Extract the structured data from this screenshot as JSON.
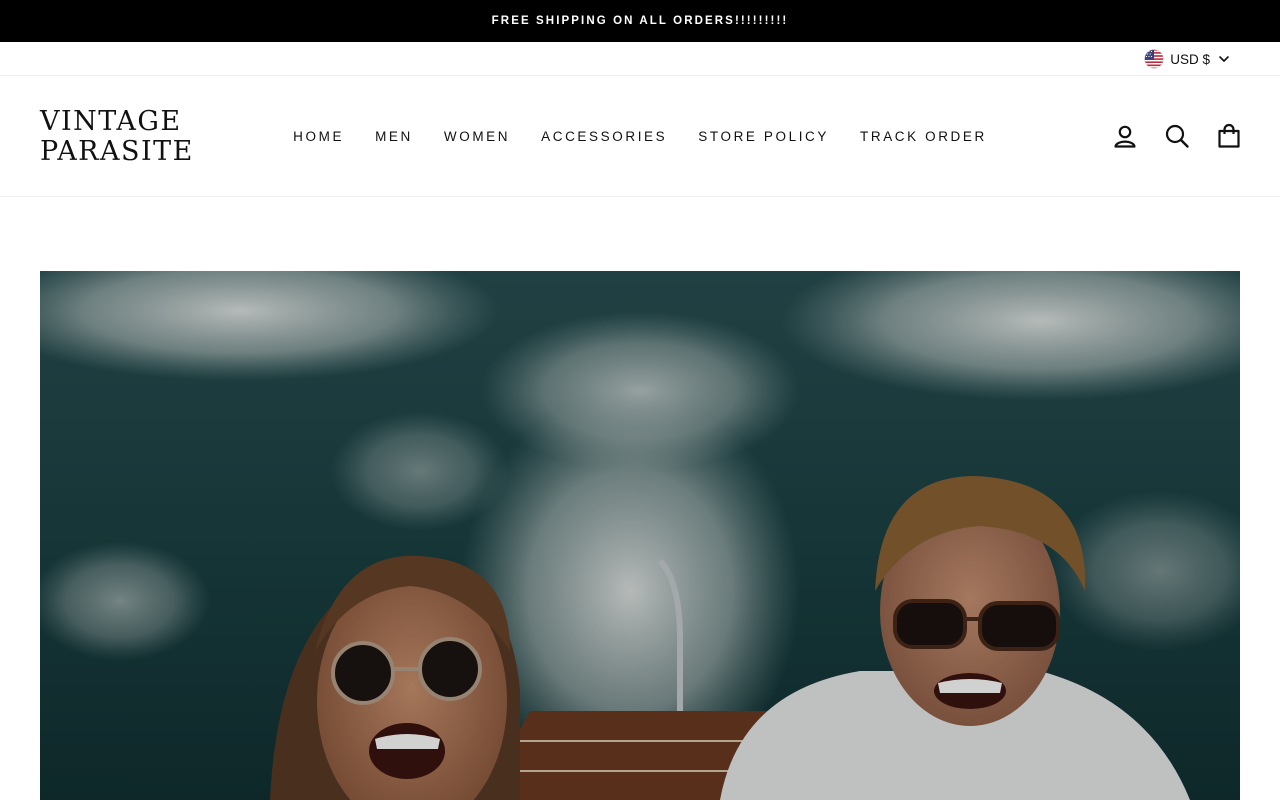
{
  "announcement": {
    "text": "FREE SHIPPING ON ALL ORDERS!!!!!!!!!"
  },
  "currency": {
    "label": "USD $",
    "flag_icon": "us-flag-icon",
    "dropdown_icon": "chevron-down-icon"
  },
  "logo": {
    "line1": "VINTAGE",
    "line2": "PARASITE"
  },
  "nav": {
    "items": [
      {
        "label": "HOME"
      },
      {
        "label": "MEN"
      },
      {
        "label": "WOMEN"
      },
      {
        "label": "ACCESSORIES"
      },
      {
        "label": "STORE POLICY"
      },
      {
        "label": "TRACK ORDER"
      }
    ]
  },
  "header_icons": {
    "account": "user-icon",
    "search": "search-icon",
    "cart": "shopping-bag-icon"
  },
  "colors": {
    "announcement_bg": "#000000",
    "announcement_text": "#ffffff",
    "text": "#111111",
    "background": "#ffffff"
  }
}
